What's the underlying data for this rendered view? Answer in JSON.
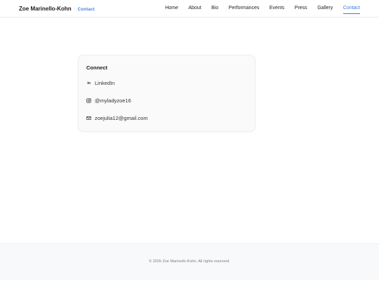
{
  "brand": {
    "name": "Zoe Marinello-Kohn",
    "separator": ":",
    "page": "Contact"
  },
  "nav": {
    "items": [
      {
        "label": "Home"
      },
      {
        "label": "About"
      },
      {
        "label": "Bio"
      },
      {
        "label": "Performances"
      },
      {
        "label": "Events"
      },
      {
        "label": "Press"
      },
      {
        "label": "Gallery"
      },
      {
        "label": "Contact",
        "active": true
      }
    ]
  },
  "connect": {
    "title": "Connect",
    "links": [
      {
        "icon": "linkedin-icon",
        "glyph": "in",
        "label": "LinkedIn"
      },
      {
        "icon": "instagram-icon",
        "label": "@myladyzoe16"
      },
      {
        "icon": "mail-icon",
        "label": "zoejulia12@gmail.com"
      }
    ]
  },
  "footer": {
    "text": "© 2026 Zoe Marinello-Kohn. All rights reserved."
  },
  "colors": {
    "accent": "#3b7dd8",
    "text": "#1f2328",
    "muted": "#7a828a"
  }
}
